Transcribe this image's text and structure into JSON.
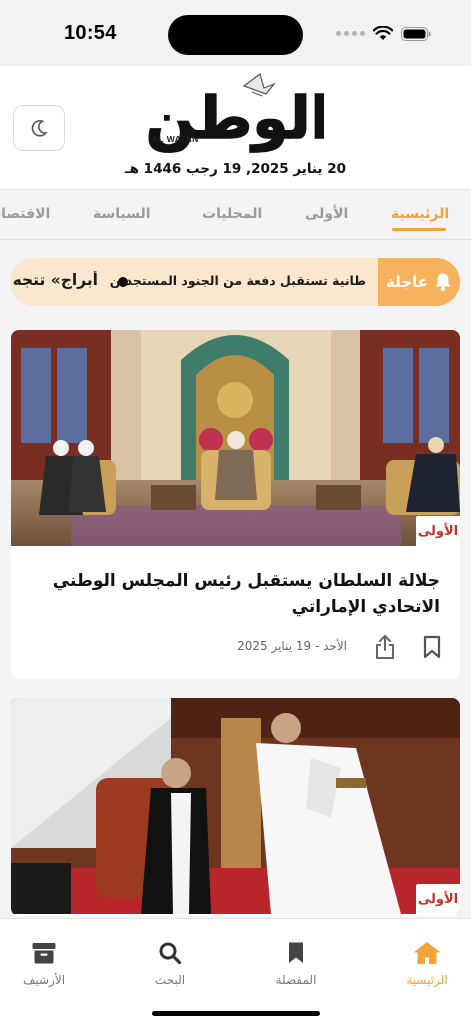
{
  "status_bar": {
    "time": "10:54"
  },
  "header": {
    "logo_text": "الوطن",
    "logo_latin": "AL WATAN",
    "date": "20 يناير 2025, 19 رجب 1446 هـ"
  },
  "tabs": [
    {
      "label": "الرئيسية",
      "active": true
    },
    {
      "label": "الأولى",
      "active": false
    },
    {
      "label": "المحليات",
      "active": false
    },
    {
      "label": "السياسة",
      "active": false
    },
    {
      "label": "الاقتصاد",
      "active": false
    }
  ],
  "breaking": {
    "label": "عاجلة",
    "headline": "طانية تستقبل دفعة من الجنود المستجدين",
    "next_headline": "أبراج» تتجه"
  },
  "articles": [
    {
      "category": "الأولى",
      "title": "جلالة السلطان يستقبل رئيس المجلس الوطني الاتحادي الإماراتي",
      "date": "الأحد - 19 يناير 2025"
    },
    {
      "category": "الأولى",
      "title": "",
      "date": ""
    }
  ],
  "bottom_nav": [
    {
      "label": "الرئيسية",
      "icon": "home-icon",
      "active": true
    },
    {
      "label": "المفضلة",
      "icon": "bookmark-icon",
      "active": false
    },
    {
      "label": "البحث",
      "icon": "search-icon",
      "active": false
    },
    {
      "label": "الأرشيف",
      "icon": "archive-icon",
      "active": false
    }
  ],
  "colors": {
    "accent": "#f2a33a",
    "breaking_bg": "#fbe7cd",
    "category_red": "#c9302c"
  }
}
